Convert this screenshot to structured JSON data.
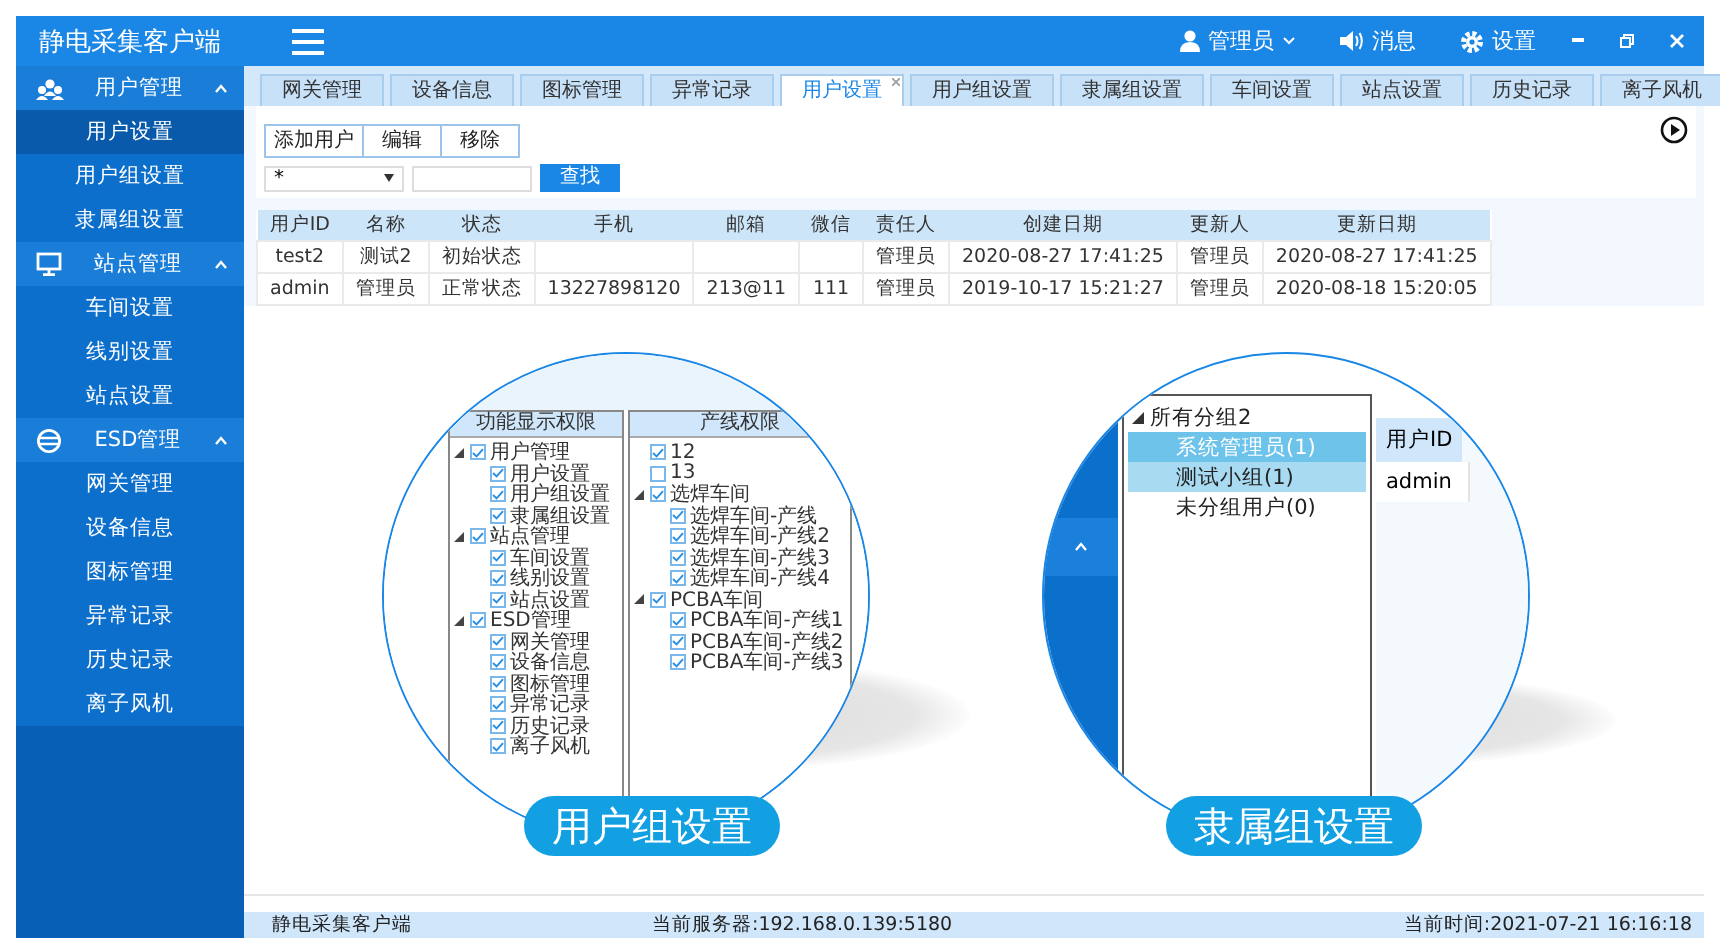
{
  "header": {
    "title": "静电采集客户端",
    "user": "管理员",
    "messages": "消息",
    "settings": "设置"
  },
  "sidebar": [
    {
      "label": "用户管理",
      "expanded": true,
      "items": [
        {
          "label": "用户设置",
          "selected": true
        },
        {
          "label": "用户组设置",
          "selected": false
        },
        {
          "label": "隶属组设置",
          "selected": false
        }
      ]
    },
    {
      "label": "站点管理",
      "expanded": true,
      "items": [
        {
          "label": "车间设置",
          "selected": false
        },
        {
          "label": "线别设置",
          "selected": false
        },
        {
          "label": "站点设置",
          "selected": false
        }
      ]
    },
    {
      "label": "ESD管理",
      "expanded": true,
      "items": [
        {
          "label": "网关管理",
          "selected": false
        },
        {
          "label": "设备信息",
          "selected": false
        },
        {
          "label": "图标管理",
          "selected": false
        },
        {
          "label": "异常记录",
          "selected": false
        },
        {
          "label": "历史记录",
          "selected": false
        },
        {
          "label": "离子风机",
          "selected": false
        }
      ]
    }
  ],
  "tabs": [
    {
      "label": "网关管理",
      "selected": false
    },
    {
      "label": "设备信息",
      "selected": false
    },
    {
      "label": "图标管理",
      "selected": false
    },
    {
      "label": "异常记录",
      "selected": false
    },
    {
      "label": "用户设置",
      "selected": true
    },
    {
      "label": "用户组设置",
      "selected": false
    },
    {
      "label": "隶属组设置",
      "selected": false
    },
    {
      "label": "车间设置",
      "selected": false
    },
    {
      "label": "站点设置",
      "selected": false
    },
    {
      "label": "历史记录",
      "selected": false
    },
    {
      "label": "离子风机",
      "selected": false
    }
  ],
  "toolbar": {
    "buttons": [
      "添加用户",
      "编辑",
      "移除"
    ],
    "filter_value": "*",
    "search_button": "查找"
  },
  "table": {
    "columns": [
      "用户ID",
      "名称",
      "状态",
      "手机",
      "邮箱",
      "微信",
      "责任人",
      "创建日期",
      "更新人",
      "更新日期"
    ],
    "rows": [
      [
        "test2",
        "测试2",
        "初始状态",
        null,
        null,
        null,
        "管理员",
        "2020-08-27 17:41:25",
        "管理员",
        "2020-08-27 17:41:25"
      ],
      [
        "admin",
        "管理员",
        "正常状态",
        "13227898120",
        "213@11",
        "111",
        "管理员",
        "2019-10-17 15:21:27",
        "管理员",
        "2020-08-18 15:20:05"
      ]
    ]
  },
  "callouts": [
    {
      "kind": "permissions",
      "caption": "用户组设置",
      "panels": [
        {
          "title": "功能显示权限",
          "tree": [
            {
              "label": "用户管理",
              "checked": true,
              "expanded": true,
              "children": [
                {
                  "label": "用户设置",
                  "checked": true
                },
                {
                  "label": "用户组设置",
                  "checked": true
                },
                {
                  "label": "隶属组设置",
                  "checked": true
                }
              ]
            },
            {
              "label": "站点管理",
              "checked": true,
              "expanded": true,
              "children": [
                {
                  "label": "车间设置",
                  "checked": true
                },
                {
                  "label": "线别设置",
                  "checked": true
                },
                {
                  "label": "站点设置",
                  "checked": true
                }
              ]
            },
            {
              "label": "ESD管理",
              "checked": true,
              "expanded": true,
              "children": [
                {
                  "label": "网关管理",
                  "checked": true
                },
                {
                  "label": "设备信息",
                  "checked": true
                },
                {
                  "label": "图标管理",
                  "checked": true
                },
                {
                  "label": "异常记录",
                  "checked": true
                },
                {
                  "label": "历史记录",
                  "checked": true
                },
                {
                  "label": "离子风机",
                  "checked": true
                }
              ]
            }
          ]
        },
        {
          "title": "产线权限",
          "tree": [
            {
              "label": "12",
              "checked": true
            },
            {
              "label": "13",
              "checked": false
            },
            {
              "label": "选焊车间",
              "checked": true,
              "expanded": true,
              "children": [
                {
                  "label": "选焊车间-产线",
                  "checked": true
                },
                {
                  "label": "选焊车间-产线2",
                  "checked": true
                },
                {
                  "label": "选焊车间-产线3",
                  "checked": true
                },
                {
                  "label": "选焊车间-产线4",
                  "checked": true
                }
              ]
            },
            {
              "label": "PCBA车间",
              "checked": true,
              "expanded": true,
              "children": [
                {
                  "label": "PCBA车间-产线1",
                  "checked": true
                },
                {
                  "label": "PCBA车间-产线2",
                  "checked": true
                },
                {
                  "label": "PCBA车间-产线3",
                  "checked": true
                }
              ]
            }
          ]
        }
      ]
    },
    {
      "kind": "groups",
      "caption": "隶属组设置",
      "tree": [
        {
          "label": "所有分组2",
          "expanded": true,
          "selected": false,
          "hovered": false,
          "children": [
            {
              "label": "系统管理员(1)",
              "selected": true,
              "hovered": false
            },
            {
              "label": "测试小组(1)",
              "selected": false,
              "hovered": true
            },
            {
              "label": "未分组用户(0)",
              "selected": false,
              "hovered": false
            }
          ]
        }
      ],
      "table": {
        "columns": [
          "用户ID"
        ],
        "rows": [
          [
            "admin"
          ]
        ]
      }
    }
  ],
  "status_bar": {
    "app": "静电采集客户端",
    "server": "当前服务器:192.168.0.139:5180",
    "time": "当前时间:2021-07-21 16:16:18"
  }
}
